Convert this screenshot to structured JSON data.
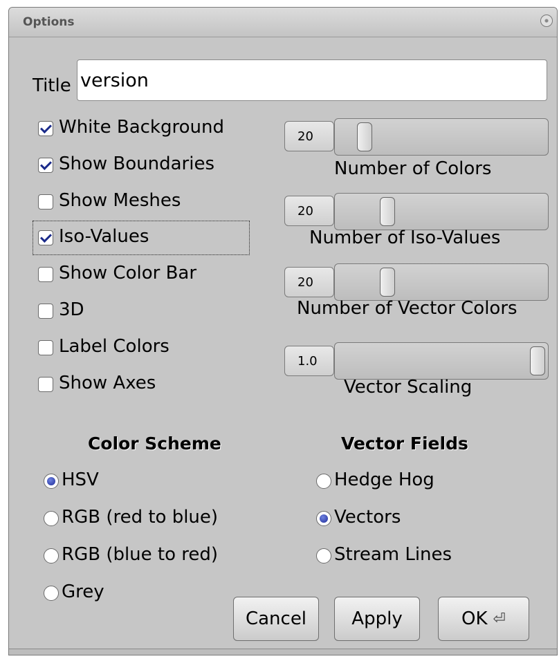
{
  "window": {
    "title": "Options"
  },
  "title_field": {
    "label": "Title",
    "value": "version"
  },
  "checkboxes": [
    {
      "label": "White Background",
      "checked": true
    },
    {
      "label": "Show Boundaries",
      "checked": true
    },
    {
      "label": "Show Meshes",
      "checked": false
    },
    {
      "label": "Iso-Values",
      "checked": true
    },
    {
      "label": "Show Color Bar",
      "checked": false
    },
    {
      "label": "3D",
      "checked": false
    },
    {
      "label": "Label Colors",
      "checked": false
    },
    {
      "label": "Show Axes",
      "checked": false
    }
  ],
  "sliders": [
    {
      "value": "20",
      "caption": "Number of Colors",
      "position": 0.1
    },
    {
      "value": "20",
      "caption": "Number of Iso-Values",
      "position": 0.22
    },
    {
      "value": "20",
      "caption": "Number of Vector Colors",
      "position": 0.22
    },
    {
      "value": "1.0",
      "caption": "Vector Scaling",
      "position": 1.0
    }
  ],
  "color_scheme": {
    "heading": "Color Scheme",
    "options": [
      {
        "label": "HSV",
        "selected": true
      },
      {
        "label": "RGB (red to blue)",
        "selected": false
      },
      {
        "label": "RGB (blue to red)",
        "selected": false
      },
      {
        "label": "Grey",
        "selected": false
      }
    ]
  },
  "vector_fields": {
    "heading": "Vector Fields",
    "options": [
      {
        "label": "Hedge Hog",
        "selected": false
      },
      {
        "label": "Vectors",
        "selected": true
      },
      {
        "label": "Stream Lines",
        "selected": false
      }
    ]
  },
  "buttons": {
    "cancel": "Cancel",
    "apply": "Apply",
    "ok": "OK"
  },
  "icons": {
    "close": "close-icon",
    "enter": "enter-icon"
  }
}
